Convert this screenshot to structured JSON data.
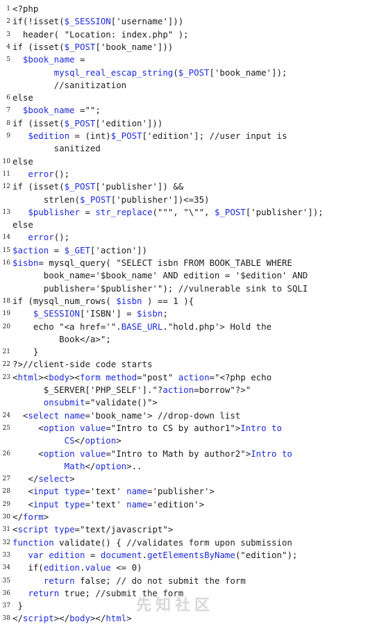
{
  "watermark": "先知社区",
  "lines": [
    {
      "n": "1",
      "seg": [
        {
          "t": "<?php"
        }
      ]
    },
    {
      "n": "2",
      "seg": [
        {
          "t": "if(!isset("
        },
        {
          "t": "$_SESSION",
          "k": 1
        },
        {
          "t": "['username']))"
        }
      ]
    },
    {
      "n": "3",
      "seg": [
        {
          "t": "  header( \"Location: index.php\" );"
        }
      ]
    },
    {
      "n": "4",
      "seg": [
        {
          "t": "if (isset("
        },
        {
          "t": "$_POST",
          "k": 1
        },
        {
          "t": "['book_name']))"
        }
      ]
    },
    {
      "n": "5",
      "seg": [
        {
          "t": "  "
        },
        {
          "t": "$book_name",
          "k": 1
        },
        {
          "t": " ="
        }
      ]
    },
    {
      "n": "",
      "seg": [
        {
          "t": "        "
        },
        {
          "t": "mysql_real_escap_string",
          "k": 1
        },
        {
          "t": "("
        },
        {
          "t": "$_POST",
          "k": 1
        },
        {
          "t": "['book_name']);"
        }
      ]
    },
    {
      "n": "",
      "seg": [
        {
          "t": "        //sanitization",
          "c": 1
        }
      ]
    },
    {
      "n": "6",
      "seg": [
        {
          "t": "else"
        }
      ]
    },
    {
      "n": "7",
      "seg": [
        {
          "t": "  "
        },
        {
          "t": "$book_name",
          "k": 1
        },
        {
          "t": " =\"\";"
        }
      ]
    },
    {
      "n": "8",
      "seg": [
        {
          "t": "if (isset("
        },
        {
          "t": "$_POST",
          "k": 1
        },
        {
          "t": "['edition']))"
        }
      ]
    },
    {
      "n": "9",
      "seg": [
        {
          "t": "   "
        },
        {
          "t": "$edition",
          "k": 1
        },
        {
          "t": " = (int)"
        },
        {
          "t": "$_POST",
          "k": 1
        },
        {
          "t": "['edition']; "
        },
        {
          "t": "//user input is",
          "c": 1
        }
      ]
    },
    {
      "n": "",
      "seg": [
        {
          "t": "        sanitized",
          "c": 1
        }
      ]
    },
    {
      "n": "10",
      "seg": [
        {
          "t": "else"
        }
      ]
    },
    {
      "n": "11",
      "seg": [
        {
          "t": "   "
        },
        {
          "t": "error",
          "k": 1
        },
        {
          "t": "();"
        }
      ]
    },
    {
      "n": "12",
      "seg": [
        {
          "t": "if (isset("
        },
        {
          "t": "$_POST",
          "k": 1
        },
        {
          "t": "['publisher']) &&"
        }
      ]
    },
    {
      "n": "",
      "seg": [
        {
          "t": "      strlen("
        },
        {
          "t": "$_POST",
          "k": 1
        },
        {
          "t": "['publisher'])<=35)"
        }
      ]
    },
    {
      "n": "13",
      "seg": [
        {
          "t": "   "
        },
        {
          "t": "$publisher",
          "k": 1
        },
        {
          "t": " = "
        },
        {
          "t": "str_replace",
          "k": 1
        },
        {
          "t": "(\"\"\", \"\\\"\", "
        },
        {
          "t": "$_POST",
          "k": 1
        },
        {
          "t": "['publisher']);"
        }
      ]
    },
    {
      "n": "",
      "seg": [
        {
          "t": "else"
        }
      ]
    },
    {
      "n": "14",
      "seg": [
        {
          "t": "   "
        },
        {
          "t": "error",
          "k": 1
        },
        {
          "t": "();"
        }
      ]
    },
    {
      "n": "15",
      "seg": [
        {
          "t": "$action",
          "k": 1
        },
        {
          "t": " = "
        },
        {
          "t": "$_GET",
          "k": 1
        },
        {
          "t": "['action'])"
        }
      ]
    },
    {
      "n": "16",
      "seg": [
        {
          "t": "$isbn",
          "k": 1
        },
        {
          "t": "= mysql_query( \"SELECT isbn FROM BOOK_TABLE WHERE"
        }
      ]
    },
    {
      "n": "",
      "seg": [
        {
          "t": "      book_name='$book_name' AND edition = '$edition' AND"
        }
      ]
    },
    {
      "n": "",
      "seg": [
        {
          "t": "      publisher='$publisher'\"); "
        },
        {
          "t": "//vulnerable sink to SQLI",
          "c": 1
        }
      ]
    },
    {
      "n": "18",
      "seg": [
        {
          "t": "if (mysql_num_rows( "
        },
        {
          "t": "$isbn",
          "k": 1
        },
        {
          "t": " ) == 1 ){"
        }
      ]
    },
    {
      "n": "19",
      "seg": [
        {
          "t": "    "
        },
        {
          "t": "$_SESSION",
          "k": 1
        },
        {
          "t": "['ISBN'] = "
        },
        {
          "t": "$isbn",
          "k": 1
        },
        {
          "t": ";"
        }
      ]
    },
    {
      "n": "20",
      "seg": [
        {
          "t": "    echo \"<a href='\"."
        },
        {
          "t": "BASE_URL",
          "k": 1
        },
        {
          "t": ".\"hold.php'> Hold the"
        }
      ]
    },
    {
      "n": "",
      "seg": [
        {
          "t": "         Book</a>\";"
        }
      ]
    },
    {
      "n": "21",
      "seg": [
        {
          "t": "    }"
        }
      ]
    },
    {
      "n": "22",
      "seg": [
        {
          "t": "?>"
        },
        {
          "t": "//client-side code starts",
          "c": 1
        }
      ]
    },
    {
      "n": "23",
      "seg": [
        {
          "t": "<"
        },
        {
          "t": "html",
          "k": 1
        },
        {
          "t": "><"
        },
        {
          "t": "body",
          "k": 1
        },
        {
          "t": "><"
        },
        {
          "t": "form",
          "k": 1
        },
        {
          "t": " "
        },
        {
          "t": "method",
          "k": 1
        },
        {
          "t": "=\"post\" "
        },
        {
          "t": "action",
          "k": 1
        },
        {
          "t": "=\"<?php echo"
        }
      ]
    },
    {
      "n": "",
      "seg": [
        {
          "t": "      $_SERVER['PHP_SELF'].\"?"
        },
        {
          "t": "action",
          "k": 1
        },
        {
          "t": "=borrow\"?>\""
        }
      ]
    },
    {
      "n": "",
      "seg": [
        {
          "t": "      "
        },
        {
          "t": "onsubmit",
          "k": 1
        },
        {
          "t": "=\"validate()\">"
        }
      ]
    },
    {
      "n": "24",
      "seg": [
        {
          "t": "  <"
        },
        {
          "t": "select",
          "k": 1
        },
        {
          "t": " "
        },
        {
          "t": "name",
          "k": 1
        },
        {
          "t": "='book_name'> "
        },
        {
          "t": "//drop-down list",
          "c": 1
        }
      ]
    },
    {
      "n": "25",
      "seg": [
        {
          "t": "     <"
        },
        {
          "t": "option",
          "k": 1
        },
        {
          "t": " "
        },
        {
          "t": "value",
          "k": 1
        },
        {
          "t": "=\"Intro to CS by author1\">"
        },
        {
          "t": "Intro to",
          "k": 1
        }
      ]
    },
    {
      "n": "",
      "seg": [
        {
          "t": "          "
        },
        {
          "t": "CS",
          "k": 1
        },
        {
          "t": "</"
        },
        {
          "t": "option",
          "k": 1
        },
        {
          "t": ">"
        }
      ]
    },
    {
      "n": "26",
      "seg": [
        {
          "t": "     <"
        },
        {
          "t": "option",
          "k": 1
        },
        {
          "t": " "
        },
        {
          "t": "value",
          "k": 1
        },
        {
          "t": "=\"Intro to Math by author2\">"
        },
        {
          "t": "Intro to",
          "k": 1
        }
      ]
    },
    {
      "n": "",
      "seg": [
        {
          "t": "          "
        },
        {
          "t": "Math",
          "k": 1
        },
        {
          "t": "</"
        },
        {
          "t": "option",
          "k": 1
        },
        {
          "t": ">.."
        }
      ]
    },
    {
      "n": "27",
      "seg": [
        {
          "t": "   </"
        },
        {
          "t": "select",
          "k": 1
        },
        {
          "t": ">"
        }
      ]
    },
    {
      "n": "28",
      "seg": [
        {
          "t": "   <"
        },
        {
          "t": "input",
          "k": 1
        },
        {
          "t": " "
        },
        {
          "t": "type",
          "k": 1
        },
        {
          "t": "='text' "
        },
        {
          "t": "name",
          "k": 1
        },
        {
          "t": "='publisher'>"
        }
      ]
    },
    {
      "n": "29",
      "seg": [
        {
          "t": "   <"
        },
        {
          "t": "input",
          "k": 1
        },
        {
          "t": " "
        },
        {
          "t": "type",
          "k": 1
        },
        {
          "t": "='text' "
        },
        {
          "t": "name",
          "k": 1
        },
        {
          "t": "='edition'>"
        }
      ]
    },
    {
      "n": "30",
      "seg": [
        {
          "t": "</"
        },
        {
          "t": "form",
          "k": 1
        },
        {
          "t": ">"
        }
      ]
    },
    {
      "n": "31",
      "seg": [
        {
          "t": "<"
        },
        {
          "t": "script",
          "k": 1
        },
        {
          "t": " "
        },
        {
          "t": "type",
          "k": 1
        },
        {
          "t": "=\"text/javascript\">"
        }
      ]
    },
    {
      "n": "32",
      "seg": [
        {
          "t": "function",
          "k": 1
        },
        {
          "t": " validate() { "
        },
        {
          "t": "//validates form upon submission",
          "c": 1
        }
      ]
    },
    {
      "n": "33",
      "seg": [
        {
          "t": "   "
        },
        {
          "t": "var",
          "k": 1
        },
        {
          "t": " "
        },
        {
          "t": "edition",
          "k": 1
        },
        {
          "t": " = "
        },
        {
          "t": "document",
          "k": 1
        },
        {
          "t": "."
        },
        {
          "t": "getElementsByName",
          "k": 1
        },
        {
          "t": "(\"edition\");"
        }
      ]
    },
    {
      "n": "34",
      "seg": [
        {
          "t": "   if("
        },
        {
          "t": "edition",
          "k": 1
        },
        {
          "t": "."
        },
        {
          "t": "value",
          "k": 1
        },
        {
          "t": " <= 0)"
        }
      ]
    },
    {
      "n": "35",
      "seg": [
        {
          "t": "      "
        },
        {
          "t": "return",
          "k": 1
        },
        {
          "t": " false; "
        },
        {
          "t": "// do not submit the form",
          "c": 1
        }
      ]
    },
    {
      "n": "36",
      "seg": [
        {
          "t": "   "
        },
        {
          "t": "return",
          "k": 1
        },
        {
          "t": " true; "
        },
        {
          "t": "//submit the form",
          "c": 1
        }
      ]
    },
    {
      "n": "37",
      "seg": [
        {
          "t": " }"
        }
      ]
    },
    {
      "n": "38",
      "seg": [
        {
          "t": "</"
        },
        {
          "t": "script",
          "k": 1
        },
        {
          "t": "></"
        },
        {
          "t": "body",
          "k": 1
        },
        {
          "t": "></"
        },
        {
          "t": "html",
          "k": 1
        },
        {
          "t": ">"
        }
      ]
    }
  ]
}
